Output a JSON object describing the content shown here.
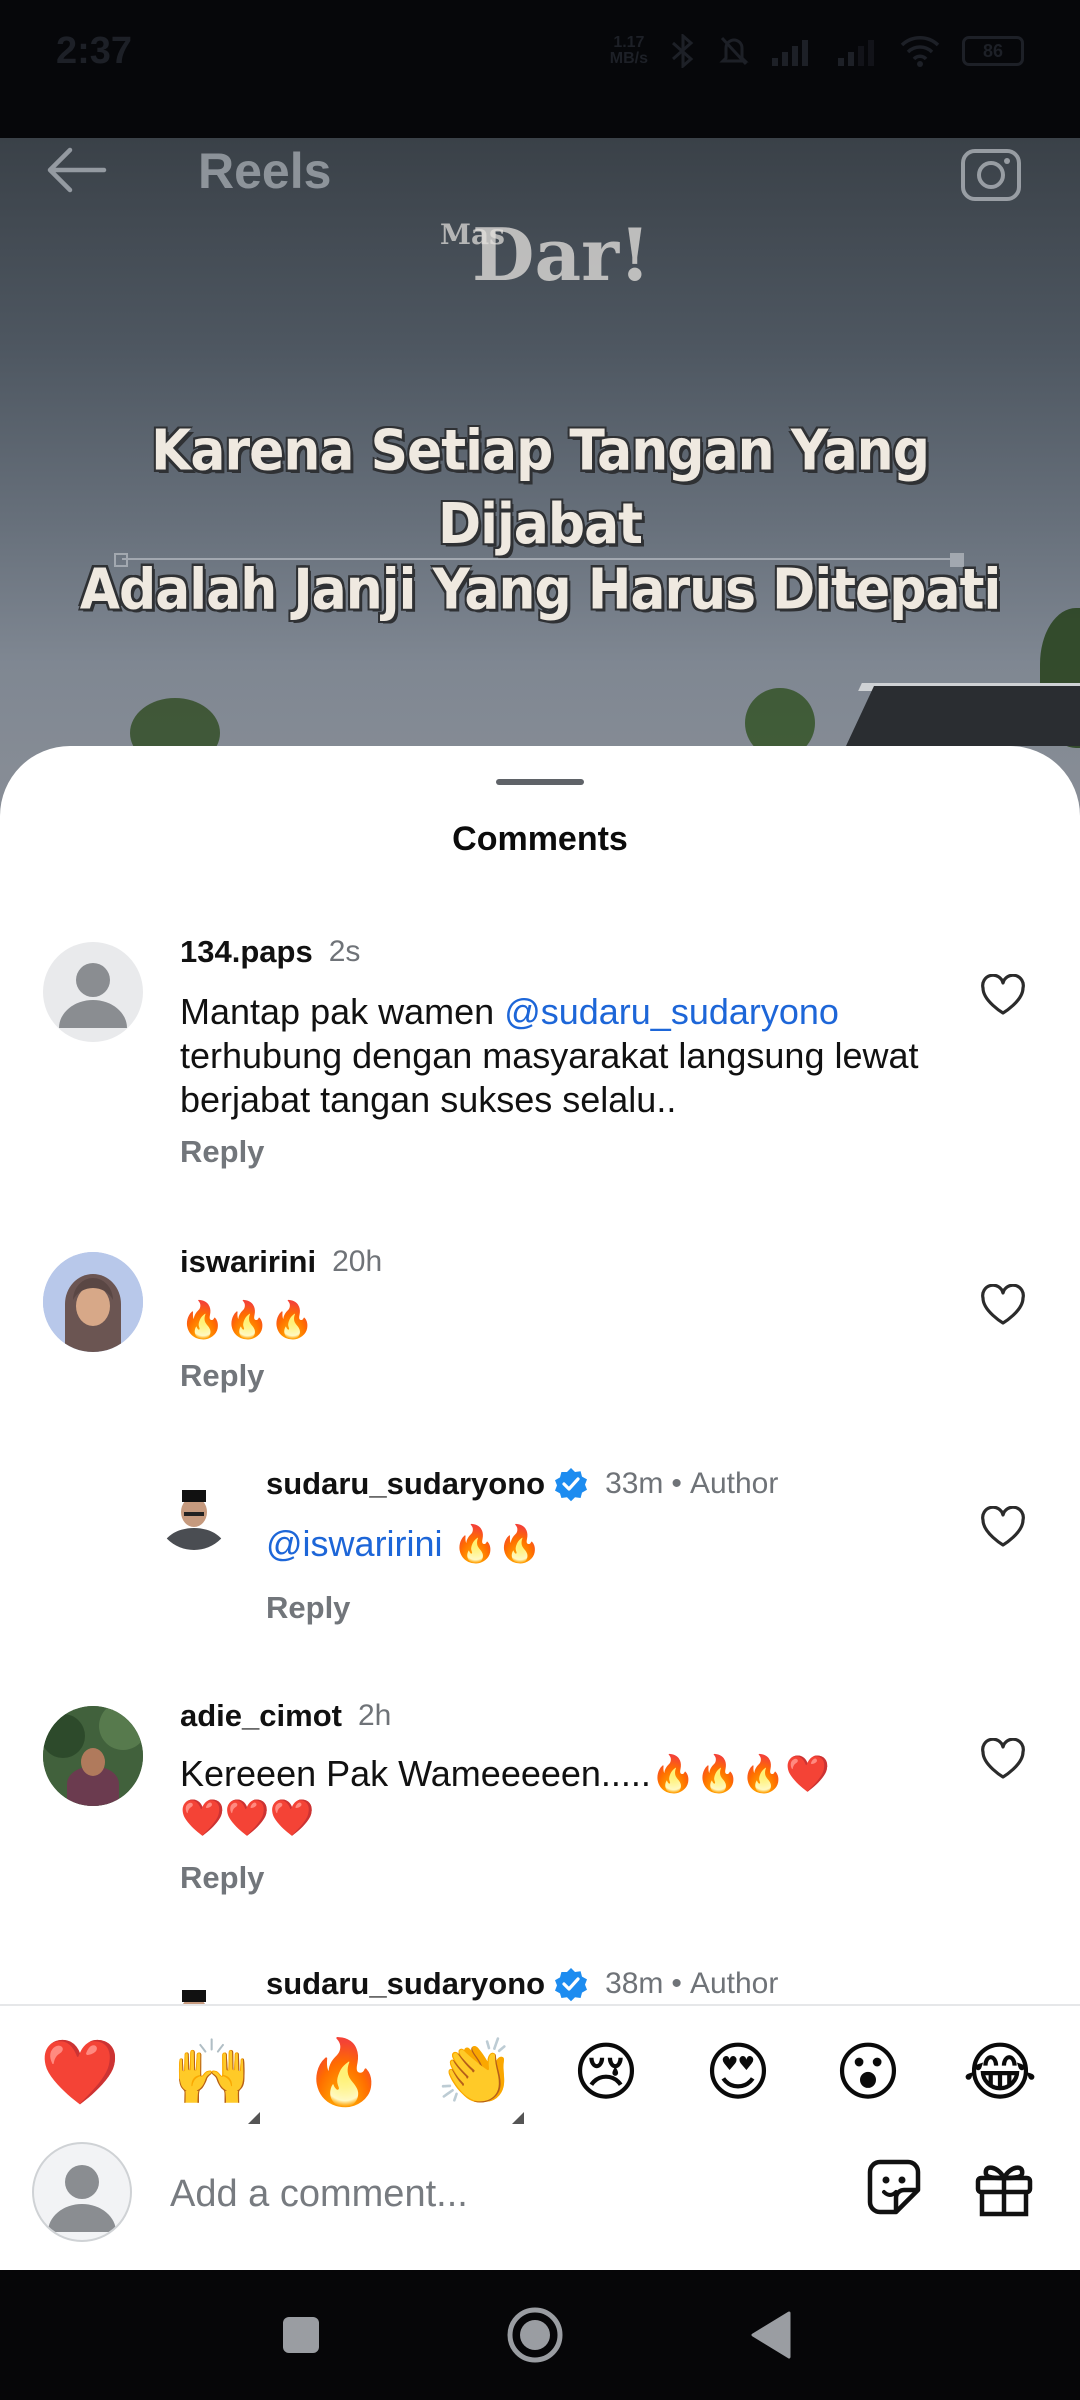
{
  "status_bar": {
    "time": "2:37",
    "net_speed_value": "1.17",
    "net_speed_unit": "MB/s",
    "battery": "86"
  },
  "header": {
    "title": "Reels"
  },
  "reel": {
    "logo_small": "Mas",
    "logo_big": "Dar!",
    "caption_line_1": "Karena Setiap Tangan Yang Dijabat",
    "caption_line_2": "Adalah Janji Yang Harus Ditepati"
  },
  "comments_sheet": {
    "title": "Comments",
    "comments": [
      {
        "username": "134.paps",
        "time": "2s",
        "text_prefix": "Mantap pak wamen ",
        "mention": "@sudaru_sudaryono",
        "text_suffix": "terhubung dengan masyarakat langsung lewat berjabat tangan sukses selalu..",
        "reply": "Reply"
      },
      {
        "username": "iswaririni",
        "time": "20h",
        "text": "🔥🔥🔥",
        "reply": "Reply"
      },
      {
        "username": "sudaru_sudaryono",
        "time": "33m",
        "separator": "•",
        "author_tag": "Author",
        "mention": "@iswaririni",
        "text": " 🔥🔥",
        "reply": "Reply"
      },
      {
        "username": "adie_cimot",
        "time": "2h",
        "text_line_1": "Kereeen Pak Wameeeeen.....🔥🔥🔥❤️",
        "text_line_2": "❤️❤️❤️",
        "reply": "Reply"
      },
      {
        "username": "sudaru_sudaryono",
        "time": "38m",
        "separator": "•",
        "author_tag": "Author"
      }
    ]
  },
  "emoji_bar": [
    "❤️",
    "🙌",
    "🔥",
    "👏",
    "😢",
    "😍",
    "😮",
    "😂"
  ],
  "input": {
    "placeholder": "Add a comment..."
  },
  "colors": {
    "mention": "#1d66d8",
    "verified": "#1d8cf0",
    "muted": "#72767b"
  }
}
